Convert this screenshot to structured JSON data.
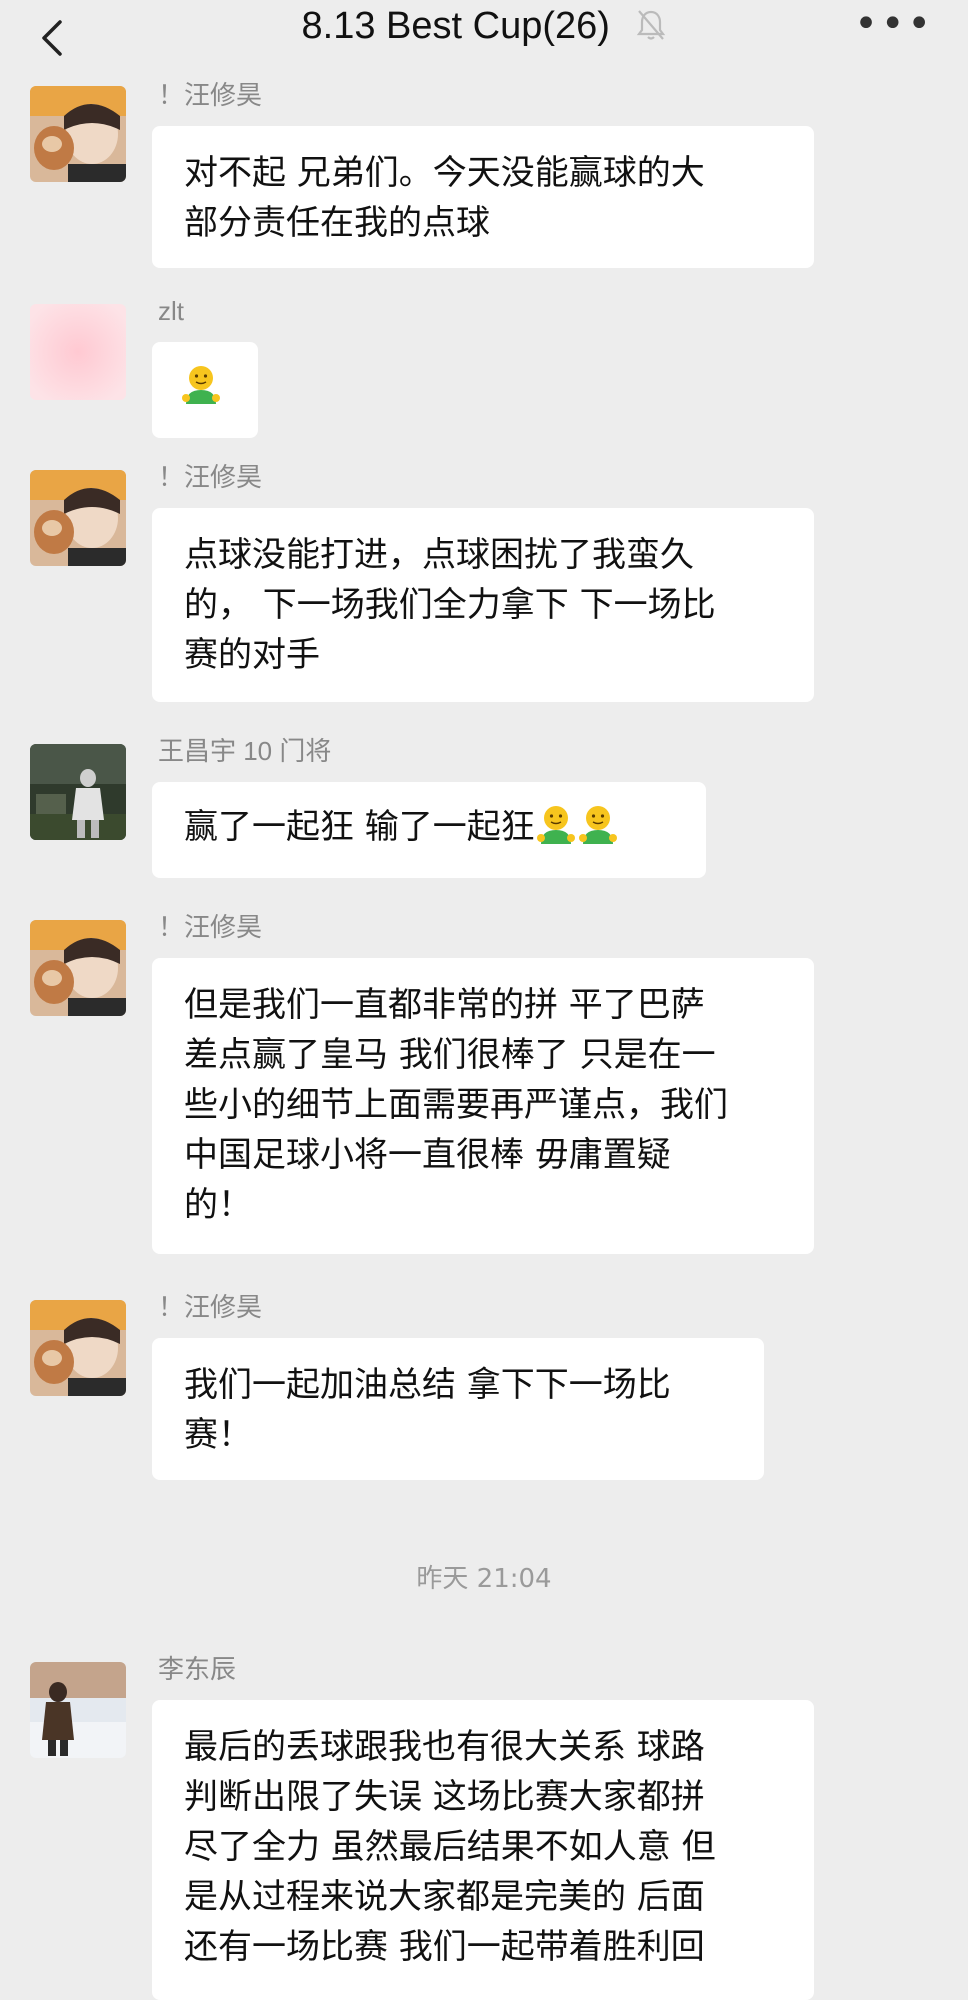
{
  "header": {
    "title": "8.13 Best Cup(26)",
    "more_label": "•••"
  },
  "messages": [
    {
      "sender": "！汪修昊",
      "avatar": "avatar-wang-xiuhao",
      "text": "对不起 兄弟们。今天没能赢球的大\n部分责任在我的点球"
    },
    {
      "sender": "zlt",
      "avatar": "avatar-zlt-blurred",
      "text": "",
      "emoji_count": 1
    },
    {
      "sender": "！汪修昊",
      "avatar": "avatar-wang-xiuhao",
      "text": "点球没能打进，点球困扰了我蛮久\n的， 下一场我们全力拿下 下一场比\n赛的对手"
    },
    {
      "sender": "王昌宇 10 门将",
      "avatar": "avatar-wang-changyu",
      "text": "赢了一起狂 输了一起狂",
      "emoji_count": 2
    },
    {
      "sender": "！汪修昊",
      "avatar": "avatar-wang-xiuhao",
      "text": "但是我们一直都非常的拼 平了巴萨\n差点赢了皇马 我们很棒了 只是在一\n些小的细节上面需要再严谨点，我们\n中国足球小将一直很棒 毋庸置疑\n的！"
    },
    {
      "sender": "！汪修昊",
      "avatar": "avatar-wang-xiuhao",
      "text": "我们一起加油总结 拿下下一场比\n赛！"
    },
    {
      "sender": "李东辰",
      "avatar": "avatar-li-dongchen",
      "text": "最后的丢球跟我也有很大关系 球路\n判断出限了失误 这场比赛大家都拼\n尽了全力 虽然最后结果不如人意 但\n是从过程来说大家都是完美的 后面\n还有一场比赛 我们一起带着胜利回"
    }
  ],
  "timestamp": "昨天 21:04",
  "colors": {
    "background": "#ededed",
    "bubble": "#ffffff",
    "sender_text": "#888888",
    "timestamp_text": "#9a9a9a"
  }
}
